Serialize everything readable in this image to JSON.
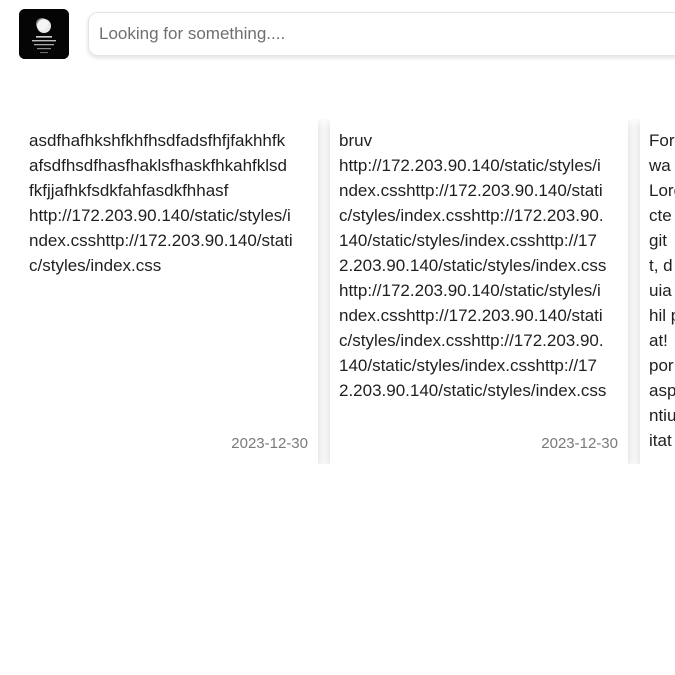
{
  "header": {
    "logo_icon": "moon-over-water-icon",
    "search": {
      "placeholder": "Looking for something....",
      "value": ""
    }
  },
  "notes": [
    {
      "lines": [
        "asdfhafhkshfkhfhsdfadsfhfjfakhhfk",
        "afsdfhsdfhasfhaklsfhaskfhkahfklsd",
        "fkfjjafhkfsdkfahfasdkfhhasf",
        "http://172.203.90.140/static/styles/i",
        "ndex.csshttp://172.203.90.140/stati",
        "c/styles/index.css"
      ],
      "date": "2023-12-30"
    },
    {
      "lines": [
        "bruv",
        "http://172.203.90.140/static/styles/i",
        "ndex.csshttp://172.203.90.140/stati",
        "c/styles/index.csshttp://172.203.90.",
        "140/static/styles/index.csshttp://17",
        "2.203.90.140/static/styles/index.css",
        "http://172.203.90.140/static/styles/i",
        "ndex.csshttp://172.203.90.140/stati",
        "c/styles/index.csshttp://172.203.90.",
        "140/static/styles/index.csshttp://17",
        "2.203.90.140/static/styles/index.css"
      ],
      "date": "2023-12-30"
    },
    {
      "lines": [
        "For",
        "wa",
        "Lore",
        "cte",
        "git",
        "t, d",
        "uia",
        "hil p",
        "at!",
        "por",
        "asp",
        "ntiu",
        "itat"
      ],
      "date": ""
    }
  ]
}
